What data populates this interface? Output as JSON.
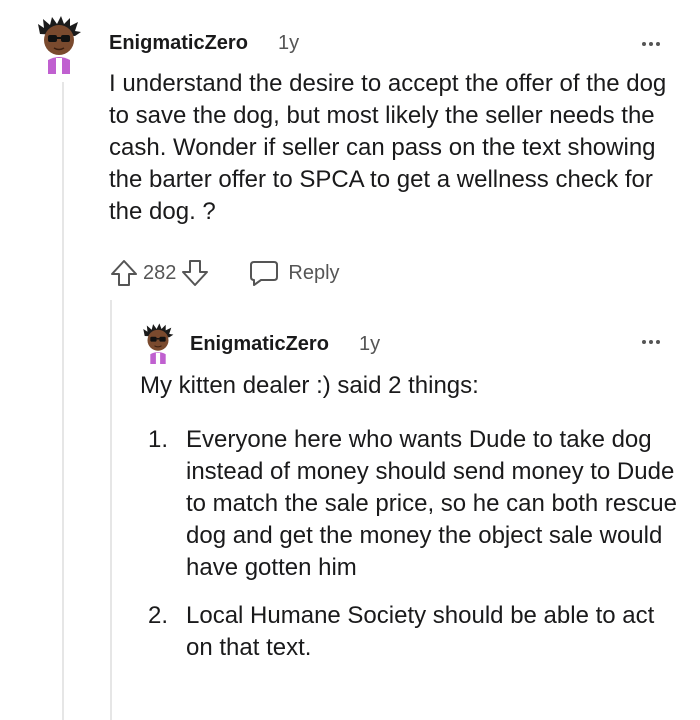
{
  "comments": [
    {
      "username": "EnigmaticZero",
      "age": "1y",
      "text": "I understand the desire to accept the offer of the dog to save the dog, but most likely the seller needs the cash. Wonder if seller can pass on the text showing the barter offer to SPCA to get a wellness check for the dog. ?",
      "score": "282",
      "reply_label": "Reply"
    },
    {
      "username": "EnigmaticZero",
      "age": "1y",
      "intro": "My kitten dealer :) said 2 things:",
      "points": [
        {
          "num": "1.",
          "text": "Everyone here who wants Dude to take dog instead of money should send money to Dude to match the sale price, so he can both rescue dog and get the money the object sale would have gotten him"
        },
        {
          "num": "2.",
          "text": "Local Humane Society should be able to act on that text."
        }
      ]
    }
  ],
  "icons": {
    "upvote": "upvote-arrow-icon",
    "downvote": "downvote-arrow-icon",
    "reply": "speech-bubble-icon",
    "more": "more-dots-icon"
  },
  "colors": {
    "text": "#1a1a1b",
    "meta": "#555555",
    "avatar_shirt": "#c060d0",
    "thread_line": "#e6e6e6"
  }
}
